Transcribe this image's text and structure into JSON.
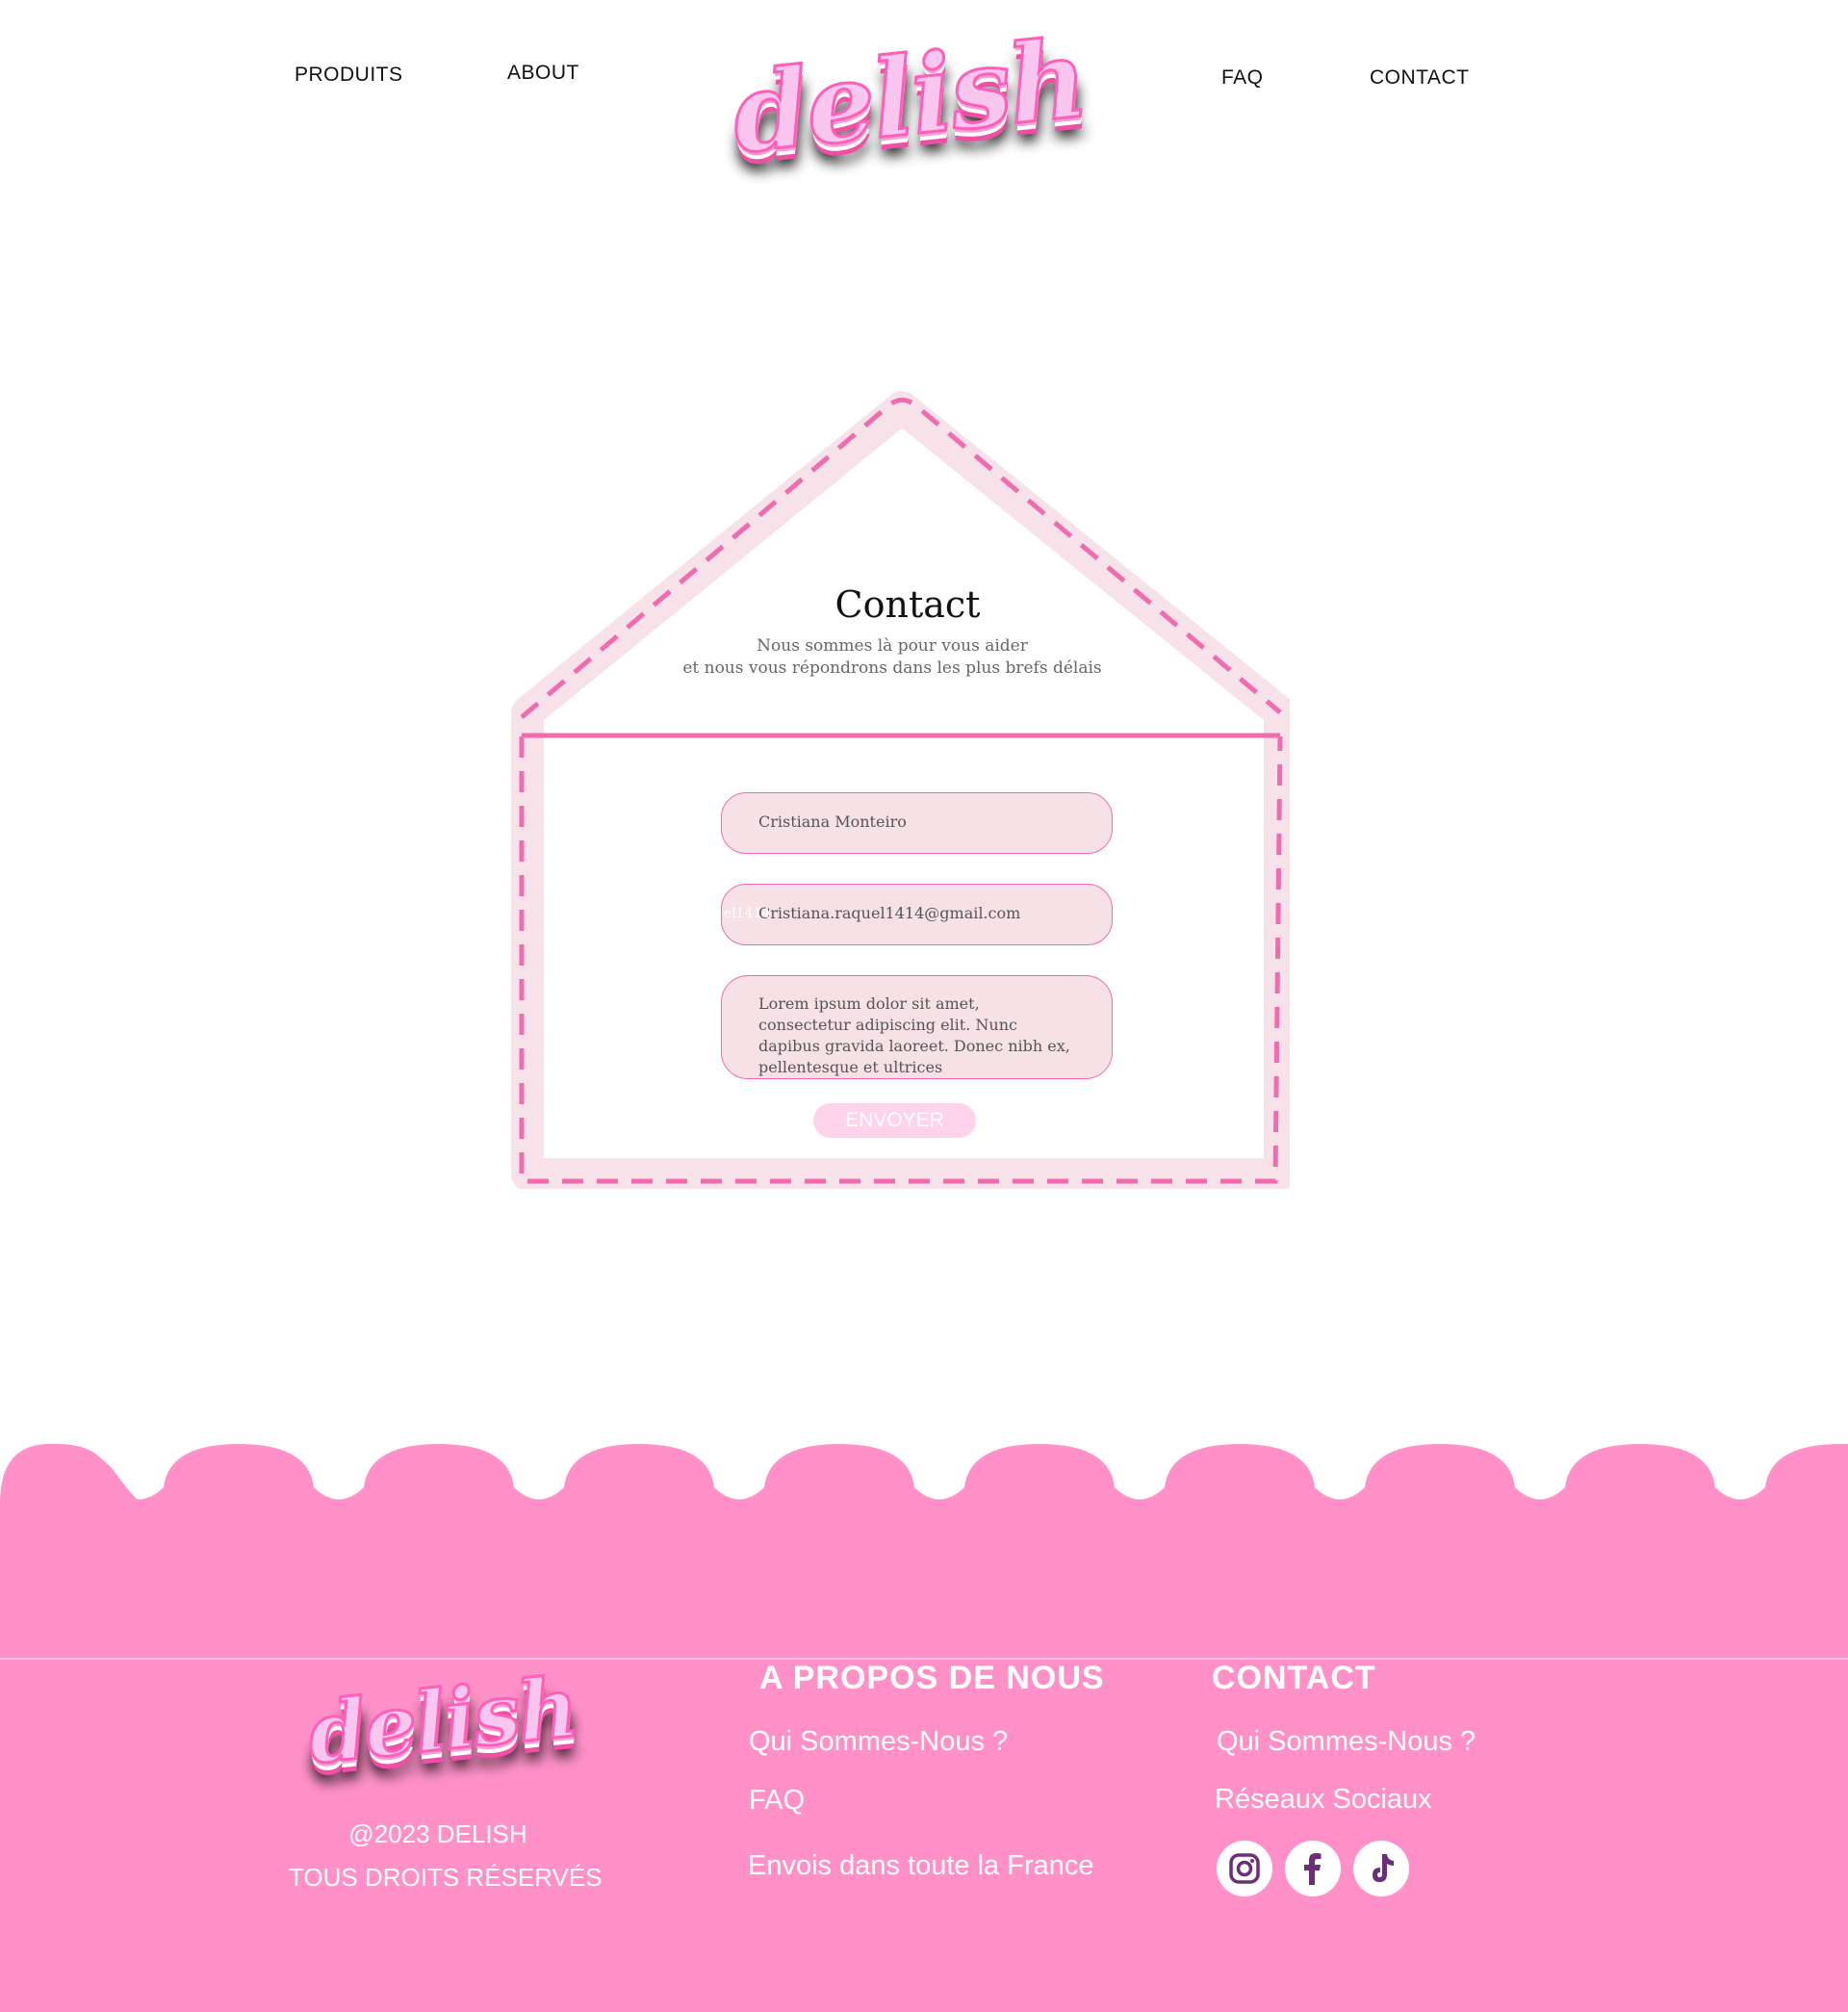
{
  "nav": {
    "left": [
      {
        "label": "PRODUITS"
      },
      {
        "label": "ABOUT"
      }
    ],
    "right": [
      {
        "label": "FAQ"
      },
      {
        "label": "CONTACT"
      }
    ],
    "logo_text": "delish"
  },
  "contact": {
    "title": "Contact",
    "subtitle_line1": "Nous sommes là pour vous aider",
    "subtitle_line2": "et nous vous répondrons dans les plus brefs délais",
    "name_value": "Cristiana Monteiro",
    "email_value": "Cristiana.raquel1414@gmail.com",
    "email_ghost": "el1414",
    "message_value": "Lorem ipsum dolor sit amet, consectetur adipiscing elit. Nunc dapibus gravida laoreet. Donec nibh ex, pellentesque et ultrices",
    "send_label": "ENVOYER"
  },
  "footer": {
    "logo_text": "delish",
    "copyright_line1": "@2023  DELISH",
    "copyright_line2": "TOUS DROITS RÉSERVÉS",
    "about_heading": "A PROPOS DE NOUS",
    "about_links": [
      {
        "label": "Qui Sommes-Nous ?"
      },
      {
        "label": "FAQ"
      },
      {
        "label": "Envois dans toute la France"
      }
    ],
    "contact_heading": "CONTACT",
    "contact_links": [
      {
        "label": "Qui Sommes-Nous ?"
      },
      {
        "label": "Réseaux Sociaux"
      }
    ],
    "socials": [
      {
        "icon": "instagram-icon"
      },
      {
        "icon": "facebook-icon"
      },
      {
        "icon": "tiktok-icon"
      }
    ]
  },
  "colors": {
    "accent_pink": "#ff91c8",
    "dash_pink": "#f06bb0",
    "icon_purple": "#6b2f78"
  }
}
